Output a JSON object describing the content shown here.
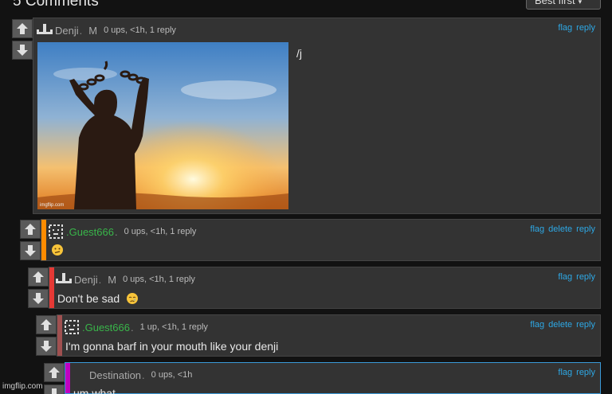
{
  "header": {
    "title": "5 Comments",
    "sort_label": "Best first"
  },
  "comments": [
    {
      "user": "Denji",
      "dot": ".",
      "badge": "M",
      "stats": "0 ups, <1h, 1 reply",
      "text": "/j",
      "actions": [
        "flag",
        "reply"
      ],
      "bar_color": "",
      "image_watermark": "imgflip.com"
    },
    {
      "user": ".Guest666",
      "dot": ".",
      "badge": "",
      "stats": "0 ups, <1h, 1 reply",
      "text": "",
      "emoji": "confused-face",
      "actions": [
        "flag",
        "delete",
        "reply"
      ],
      "bar_color": "#ff8c00"
    },
    {
      "user": "Denji",
      "dot": ".",
      "badge": "M",
      "stats": "0 ups, <1h, 1 reply",
      "text": "Don't be sad",
      "emoji": "crying-face",
      "actions": [
        "flag",
        "reply"
      ],
      "bar_color": "#e53935"
    },
    {
      "user": ".Guest666",
      "dot": ".",
      "badge": "",
      "stats": "1 up, <1h, 1 reply",
      "text": "I'm gonna barf in your mouth like your denji",
      "actions": [
        "flag",
        "delete",
        "reply"
      ],
      "bar_color": "#a05050"
    },
    {
      "user": "Destination",
      "dot": ".",
      "badge": "",
      "stats": "0 ups, <1h",
      "text": "um what",
      "actions": [
        "flag",
        "reply"
      ],
      "bar_color": "#c000c0"
    }
  ],
  "footer": {
    "watermark": "imgflip.com"
  },
  "colors": {
    "background": "#121212",
    "card": "#333333",
    "link": "#2ea8e5",
    "guest_name": "#39b54a"
  }
}
